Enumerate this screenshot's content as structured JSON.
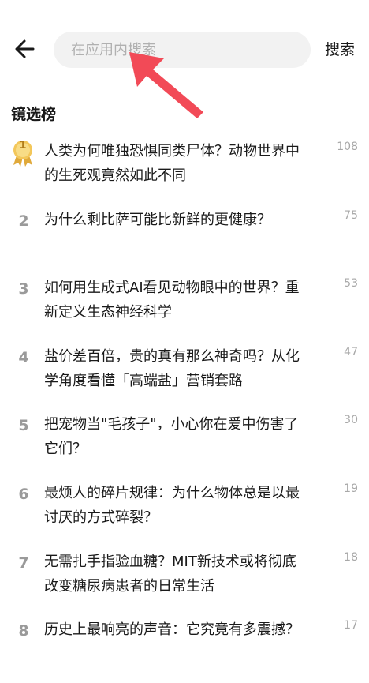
{
  "header": {
    "search_placeholder": "在应用内搜索",
    "search_button_label": "搜索"
  },
  "section": {
    "title": "镜选榜"
  },
  "items": [
    {
      "rank": "1",
      "title": "人类为何唯独恐惧同类尸体？动物世界中的生死观竟然如此不同",
      "count": "108"
    },
    {
      "rank": "2",
      "title": "为什么剩比萨可能比新鲜的更健康？",
      "count": "75"
    },
    {
      "rank": "3",
      "title": "如何用生成式AI看见动物眼中的世界？重新定义生态神经科学",
      "count": "53"
    },
    {
      "rank": "4",
      "title": "盐价差百倍，贵的真有那么神奇吗？从化学角度看懂「高端盐」营销套路",
      "count": "47"
    },
    {
      "rank": "5",
      "title": "把宠物当\"毛孩子\"，小心你在爱中伤害了它们？",
      "count": "30"
    },
    {
      "rank": "6",
      "title": "最烦人的碎片规律：为什么物体总是以最讨厌的方式碎裂？",
      "count": "19"
    },
    {
      "rank": "7",
      "title": "无需扎手指验血糖？MIT新技术或将彻底改变糖尿病患者的日常生活",
      "count": "18"
    },
    {
      "rank": "8",
      "title": "历史上最响亮的声音：它究竟有多震撼？",
      "count": "17"
    }
  ],
  "colors": {
    "medal": "#e8b84a",
    "arrow": "#f24a57",
    "rank_gray": "#9a9a9a"
  },
  "icons": {
    "back": "arrow-left-icon",
    "medal": "gold-medal-icon",
    "annotation": "red-arrow-icon"
  }
}
